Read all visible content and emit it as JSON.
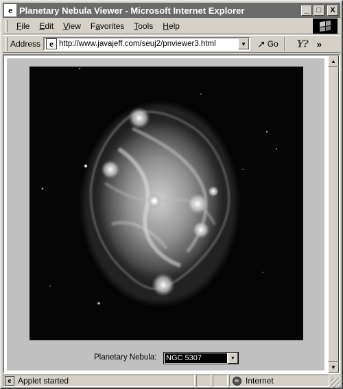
{
  "window": {
    "title": "Planetary Nebula Viewer - Microsoft Internet Explorer",
    "controls": {
      "minimize": "_",
      "maximize": "□",
      "close": "X"
    }
  },
  "menubar": {
    "items": [
      {
        "label": "File",
        "accel": "F",
        "rest": "ile"
      },
      {
        "label": "Edit",
        "accel": "E",
        "rest": "dit"
      },
      {
        "label": "View",
        "accel": "V",
        "rest": "iew"
      },
      {
        "label": "Favorites",
        "accel": "a",
        "pre": "F",
        "rest": "vorites"
      },
      {
        "label": "Tools",
        "accel": "T",
        "rest": "ools"
      },
      {
        "label": "Help",
        "accel": "H",
        "rest": "elp"
      }
    ]
  },
  "addressbar": {
    "label": "Address",
    "url": "http://www.javajeff.com/seuj2/pnviewer3.html",
    "go_label": "Go",
    "more": "»"
  },
  "applet": {
    "image_alt": "Planetary nebula image",
    "selector_label": "Planetary Nebula:",
    "selected_value": "NGC 5307"
  },
  "statusbar": {
    "message": "Applet started",
    "zone": "Internet"
  },
  "icons": {
    "app": "ie-page-icon",
    "go": "go-arrow-icon",
    "zone": "globe-icon"
  }
}
